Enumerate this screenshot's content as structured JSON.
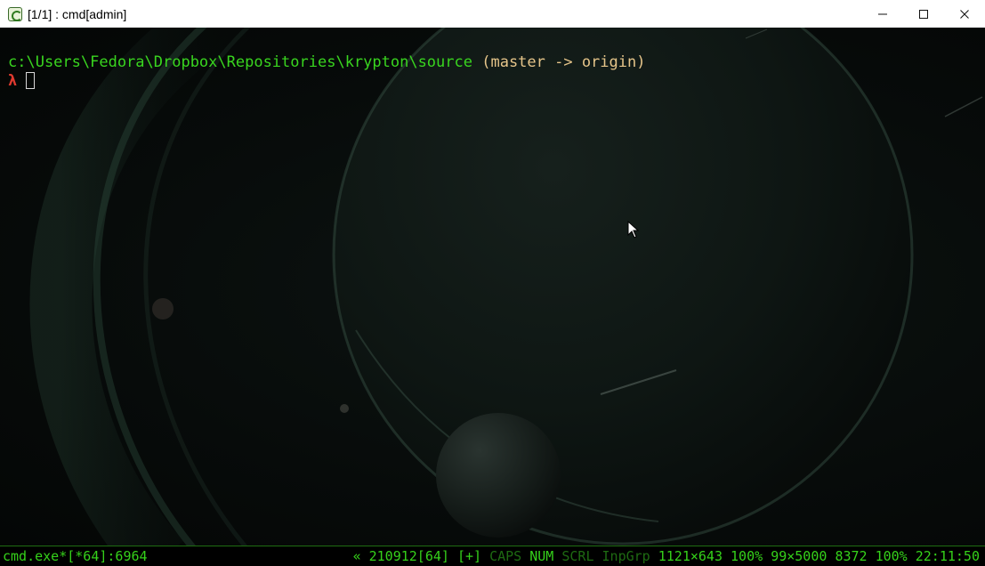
{
  "window": {
    "title": "[1/1] : cmd[admin]",
    "controls": [
      "minimize",
      "maximize",
      "close"
    ]
  },
  "terminal": {
    "prompt_path": "c:\\Users\\Fedora\\Dropbox\\Repositories\\krypton\\source",
    "git_branch": "(master -> origin)",
    "prompt_symbol": "λ",
    "input_value": ""
  },
  "statusbar": {
    "process": "cmd.exe*[*64]:6964",
    "items": {
      "scroll_marker": "«",
      "build": "210912[64]",
      "plus": "[+]",
      "caps": "CAPS",
      "num": "NUM",
      "scrl": "SCRL",
      "inpgrp": "InpGrp",
      "window_size": "1121×643",
      "zoom": "100%",
      "buffer": "99×5000",
      "pid": "8372",
      "transparency": "100%",
      "time": "22:11:50"
    }
  },
  "colors": {
    "path": "#39d51f",
    "branch": "#e6c58a",
    "lambda": "#e03a2f",
    "status_active": "#35d11a",
    "status_inactive": "#1e6a12",
    "status_border": "#1f6d12"
  },
  "icons": {
    "app": "conemu-app-icon",
    "minimize": "minimize-icon",
    "maximize": "maximize-icon",
    "close": "close-icon",
    "pointer": "mouse-pointer-icon"
  }
}
